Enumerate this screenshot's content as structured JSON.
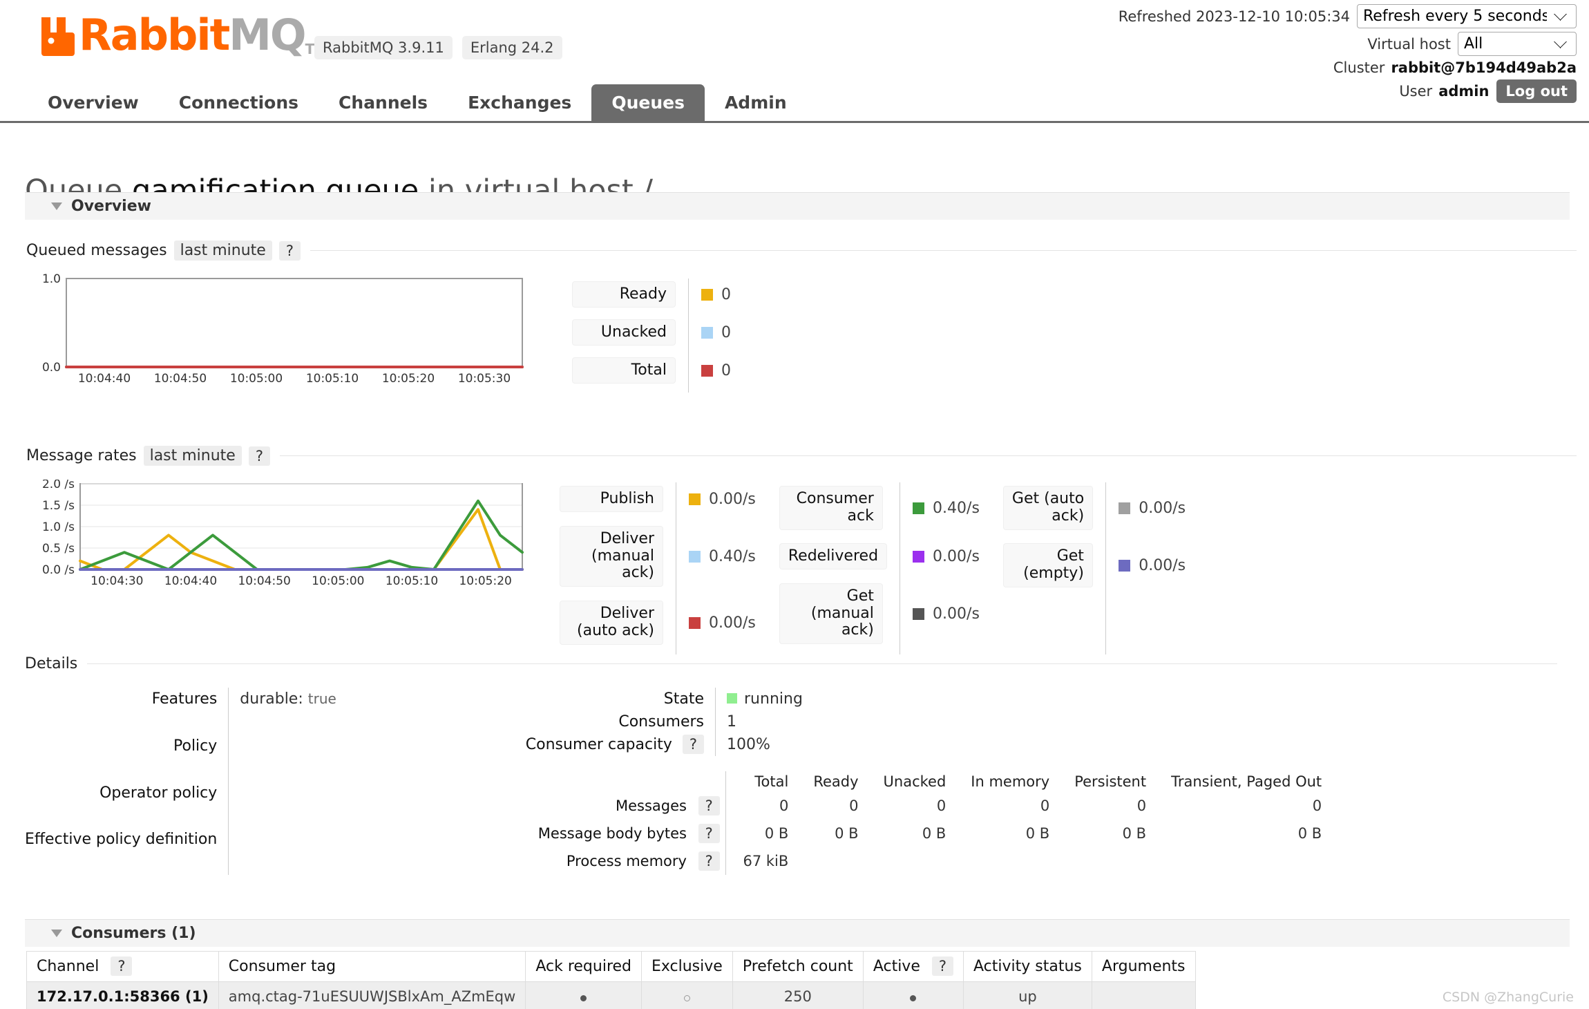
{
  "header": {
    "logo_rabbit": "Rabbit",
    "logo_mq": "MQ",
    "logo_tm": "TM",
    "version_badge": "RabbitMQ 3.9.11",
    "erlang_badge": "Erlang 24.2",
    "refreshed_label": "Refreshed 2023-12-10 10:05:34",
    "refresh_select_value": "Refresh every 5 seconds",
    "vhost_label": "Virtual host",
    "vhost_select_value": "All",
    "cluster_label": "Cluster",
    "cluster_value": "rabbit@7b194d49ab2a",
    "user_label": "User",
    "user_value": "admin",
    "logout_label": "Log out"
  },
  "nav": {
    "tabs": [
      {
        "label": "Overview",
        "active": false
      },
      {
        "label": "Connections",
        "active": false
      },
      {
        "label": "Channels",
        "active": false
      },
      {
        "label": "Exchanges",
        "active": false
      },
      {
        "label": "Queues",
        "active": true
      },
      {
        "label": "Admin",
        "active": false
      }
    ]
  },
  "page": {
    "title_prefix": "Queue",
    "queue_name": "gamification.queue",
    "title_middle": "in virtual host",
    "vhost": "/",
    "overview_section": "Overview",
    "details_section": "Details",
    "consumers_section": "Consumers (1)"
  },
  "queued_messages": {
    "title": "Queued messages",
    "period": "last minute",
    "help": "?",
    "legend": [
      {
        "label": "Ready",
        "value": "0",
        "color": "#edb10f"
      },
      {
        "label": "Unacked",
        "value": "0",
        "color": "#aad4f5"
      },
      {
        "label": "Total",
        "value": "0",
        "color": "#c9403f"
      }
    ]
  },
  "message_rates": {
    "title": "Message rates",
    "period": "last minute",
    "help": "?",
    "columns": [
      [
        {
          "label": "Publish",
          "value": "0.00/s",
          "color": "#edb10f"
        },
        {
          "label": "Deliver (manual ack)",
          "value": "0.40/s",
          "color": "#aad4f5"
        },
        {
          "label": "Deliver (auto ack)",
          "value": "0.00/s",
          "color": "#c9403f"
        }
      ],
      [
        {
          "label": "Consumer ack",
          "value": "0.40/s",
          "color": "#3c9b3c"
        },
        {
          "label": "Redelivered",
          "value": "0.00/s",
          "color": "#9b30ee"
        },
        {
          "label": "Get (manual ack)",
          "value": "0.00/s",
          "color": "#555555"
        }
      ],
      [
        {
          "label": "Get (auto ack)",
          "value": "0.00/s",
          "color": "#a0a0a0"
        },
        {
          "label": "Get (empty)",
          "value": "0.00/s",
          "color": "#6d6bc0"
        }
      ]
    ]
  },
  "chart_data": [
    {
      "type": "line",
      "title": "Queued messages",
      "subtitle": "last minute",
      "xlabel": "",
      "ylabel": "",
      "ylim": [
        0,
        1
      ],
      "yticks": [
        "0.0",
        "1.0"
      ],
      "xticks": [
        "10:04:40",
        "10:04:50",
        "10:05:00",
        "10:05:10",
        "10:05:20",
        "10:05:30"
      ],
      "grid": false,
      "legend_position": "right",
      "series": [
        {
          "name": "Ready",
          "color": "#edb10f",
          "values": [
            0,
            0,
            0,
            0,
            0,
            0,
            0,
            0,
            0,
            0,
            0,
            0,
            0
          ]
        },
        {
          "name": "Unacked",
          "color": "#aad4f5",
          "values": [
            0,
            0,
            0,
            0,
            0,
            0,
            0,
            0,
            0,
            0,
            0,
            0,
            0
          ]
        },
        {
          "name": "Total",
          "color": "#c9403f",
          "values": [
            0,
            0,
            0,
            0,
            0,
            0,
            0,
            0,
            0,
            0,
            0,
            0,
            0
          ]
        }
      ]
    },
    {
      "type": "line",
      "title": "Message rates",
      "subtitle": "last minute",
      "xlabel": "",
      "ylabel": "/s",
      "ylim": [
        0,
        2
      ],
      "yticks": [
        "0.0 /s",
        "0.5 /s",
        "1.0 /s",
        "1.5 /s",
        "2.0 /s"
      ],
      "xticks": [
        "10:04:30",
        "10:04:40",
        "10:04:50",
        "10:05:00",
        "10:05:10",
        "10:05:20"
      ],
      "grid": true,
      "legend_position": "right",
      "x": [
        0,
        1,
        2,
        3,
        4,
        5,
        6,
        7,
        8,
        9,
        10,
        11,
        12,
        13,
        14,
        15,
        16,
        17,
        18,
        19,
        20
      ],
      "series": [
        {
          "name": "Publish",
          "color": "#edb10f",
          "values": [
            0.2,
            0.0,
            0.0,
            0.4,
            0.8,
            0.4,
            0.2,
            0.0,
            0.0,
            0.0,
            0.0,
            0.0,
            0.0,
            0.0,
            0.0,
            0.0,
            0.0,
            0.7,
            1.4,
            0.0,
            0.0
          ]
        },
        {
          "name": "Consumer ack",
          "color": "#3c9b3c",
          "values": [
            0.0,
            0.2,
            0.4,
            0.2,
            0.0,
            0.4,
            0.8,
            0.4,
            0.0,
            0.0,
            0.0,
            0.0,
            0.0,
            0.05,
            0.2,
            0.05,
            0.0,
            0.8,
            1.6,
            0.8,
            0.4
          ]
        },
        {
          "name": "Redelivered",
          "color": "#6d6bc0",
          "values": [
            0,
            0,
            0,
            0,
            0,
            0,
            0,
            0,
            0,
            0,
            0,
            0,
            0,
            0,
            0,
            0,
            0,
            0,
            0,
            0,
            0
          ]
        }
      ]
    }
  ],
  "details": {
    "left": [
      {
        "label": "Features",
        "value": "durable:",
        "sub": "true"
      },
      {
        "label": "Policy",
        "value": "",
        "sub": ""
      },
      {
        "label": "Operator policy",
        "value": "",
        "sub": ""
      },
      {
        "label": "Effective policy definition",
        "value": "",
        "sub": ""
      }
    ],
    "state_label": "State",
    "state_value": "running",
    "consumers_label": "Consumers",
    "consumers_value": "1",
    "capacity_label": "Consumer capacity",
    "capacity_help": "?",
    "capacity_value": "100%",
    "stats_headers": [
      "Total",
      "Ready",
      "Unacked",
      "In memory",
      "Persistent",
      "Transient, Paged Out"
    ],
    "stats_rows": [
      {
        "label": "Messages",
        "help": "?",
        "values": [
          "0",
          "0",
          "0",
          "0",
          "0",
          "0"
        ]
      },
      {
        "label": "Message body bytes",
        "help": "?",
        "values": [
          "0 B",
          "0 B",
          "0 B",
          "0 B",
          "0 B",
          "0 B"
        ]
      },
      {
        "label": "Process memory",
        "help": "?",
        "values": [
          "67 kiB",
          "",
          "",
          "",
          "",
          ""
        ]
      }
    ]
  },
  "consumers": {
    "headers": [
      "Channel",
      "Consumer tag",
      "Ack required",
      "Exclusive",
      "Prefetch count",
      "Active",
      "Activity status",
      "Arguments"
    ],
    "channel_help": "?",
    "active_help": "?",
    "rows": [
      {
        "channel": "172.17.0.1:58366 (1)",
        "consumer_tag": "amq.ctag-71uESUUWJSBlxAm_AZmEqw",
        "ack_required": "filled-dot",
        "exclusive": "hollow-dot",
        "prefetch_count": "250",
        "active": "filled-dot",
        "activity_status": "up",
        "arguments": ""
      }
    ]
  },
  "watermark": "CSDN @ZhangCurie"
}
